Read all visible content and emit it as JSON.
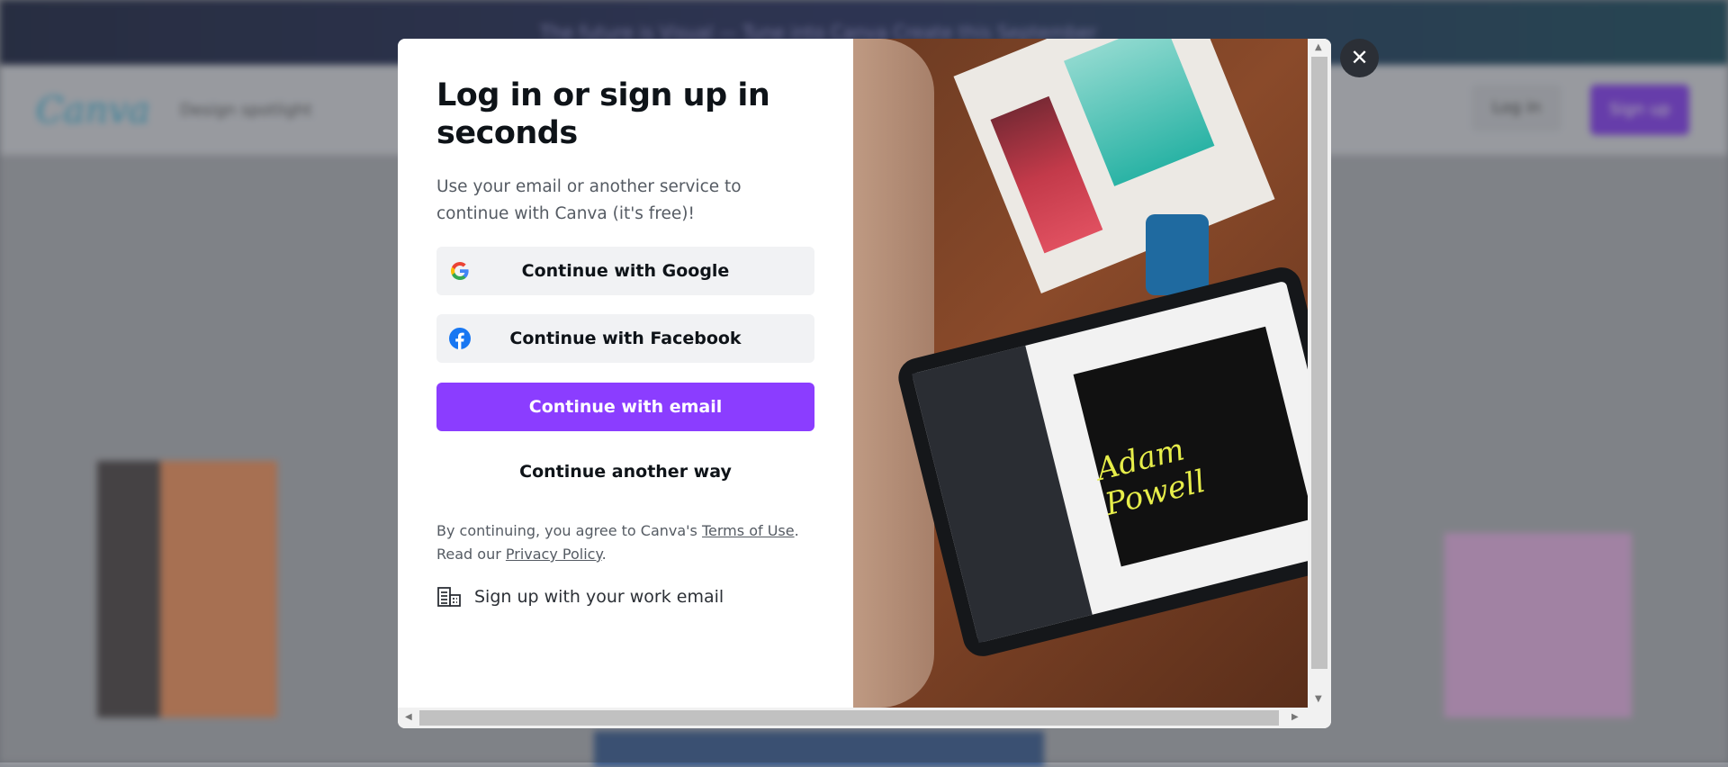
{
  "background": {
    "banner_text": "The future is Visual — Tune into Canva Create this September",
    "nav_item": "Design spotlight",
    "login_label": "Log in",
    "signup_label": "Sign up"
  },
  "modal": {
    "title": "Log in or sign up in seconds",
    "subtitle": "Use your email or another service to continue with Canva (it's free)!",
    "google_label": "Continue with Google",
    "facebook_label": "Continue with Facebook",
    "email_label": "Continue with email",
    "another_way_label": "Continue another way",
    "terms_prefix": "By continuing, you agree to Canva's ",
    "terms_link": "Terms of Use",
    "terms_mid": ". Read our ",
    "privacy_link": "Privacy Policy",
    "terms_suffix": ".",
    "work_email_label": "Sign up with your work email",
    "close_label": "✕",
    "photo_signature": "Adam Powell"
  },
  "colors": {
    "accent": "#8b3dff",
    "google_blue": "#4285f4",
    "facebook_blue": "#1877f2"
  }
}
